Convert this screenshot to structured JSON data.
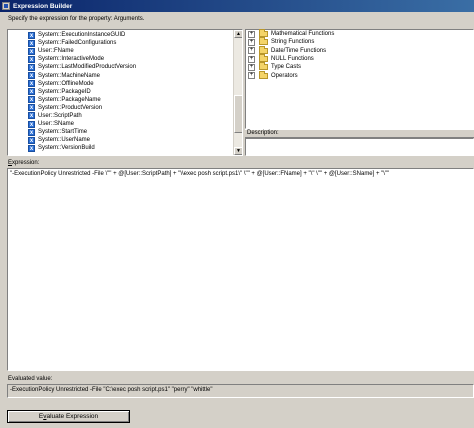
{
  "window": {
    "title": "Expression Builder"
  },
  "prompt": "Specify the expression for the property: Arguments.",
  "variables": [
    "System::ExecutionInstanceGUID",
    "System::FailedConfigurations",
    "User::FName",
    "System::InteractiveMode",
    "System::LastModifiedProductVersion",
    "System::MachineName",
    "System::OfflineMode",
    "System::PackageID",
    "System::PackageName",
    "System::ProductVersion",
    "User::ScriptPath",
    "User::SName",
    "System::StartTime",
    "System::UserName",
    "System::VersionBuild"
  ],
  "functions": [
    "Mathematical Functions",
    "String Functions",
    "Date/Time Functions",
    "NULL Functions",
    "Type Casts",
    "Operators"
  ],
  "description_label": "Description:",
  "expression_label": "Expression:",
  "expression_text": "\"-ExecutionPolicy Unrestricted -File \\\"\" + @[User::ScriptPath]  + \"\\\\exec posh script.ps1\\\" \\\"\" + @[User::FName]  + \"\\\" \\\"\" + @[User::SName]  + \"\\\"\"",
  "evaluated_label": "Evaluated value:",
  "evaluated_text": "-ExecutionPolicy Unrestricted -File \"C:\\exec posh script.ps1\" \"perry\" \"whittle\"",
  "evaluate_button": "Evaluate Expression"
}
